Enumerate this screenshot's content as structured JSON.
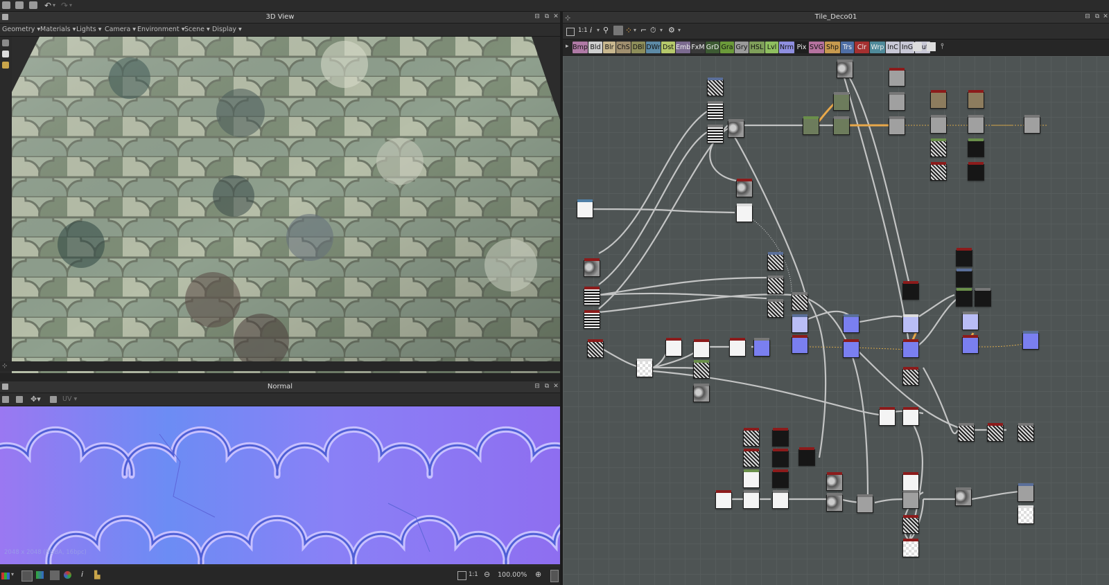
{
  "view3d": {
    "title": "3D View",
    "menu": [
      "Geometry",
      "Materials",
      "Lights",
      "Camera",
      "Environment",
      "Scene",
      "Display"
    ]
  },
  "view2d": {
    "title": "Normal",
    "toolbar_label": "UV",
    "info": "2048 x 2048 (RGBA, 16bpc)",
    "ratio": "1:1",
    "zoom": "100.00%"
  },
  "graph": {
    "title": "Tile_Deco01",
    "ratio": "1:1",
    "info_glyph": "i",
    "categories": [
      {
        "label": "Bmp",
        "color": "#b07aa6"
      },
      {
        "label": "Bld",
        "color": "#cfcfcf"
      },
      {
        "label": "Blr",
        "color": "#c9b88f"
      },
      {
        "label": "ChS",
        "color": "#a08f6f"
      },
      {
        "label": "DBl",
        "color": "#8e8e5a"
      },
      {
        "label": "DWr",
        "color": "#5d8aa6"
      },
      {
        "label": "Dst",
        "color": "#b6c96b"
      },
      {
        "label": "Emb",
        "color": "#7b6a8f"
      },
      {
        "label": "FxM",
        "color": "#3a3a3a"
      },
      {
        "label": "GrD",
        "color": "#3d5a33"
      },
      {
        "label": "Gra",
        "color": "#6b9a3a"
      },
      {
        "label": "Gry",
        "color": "#9a9a9a"
      },
      {
        "label": "HSL",
        "color": "#7f9f5a"
      },
      {
        "label": "Lvl",
        "color": "#8fbf5f"
      },
      {
        "label": "Nrm",
        "color": "#8f8fe0"
      },
      {
        "label": "Pix",
        "color": "#1e1e1e"
      },
      {
        "label": "SVG",
        "color": "#b5729f"
      },
      {
        "label": "Shp",
        "color": "#c79a4f"
      },
      {
        "label": "Trs",
        "color": "#4f6fa5"
      },
      {
        "label": "Clr",
        "color": "#a53030"
      },
      {
        "label": "Wrp",
        "color": "#4f8a9a"
      },
      {
        "label": "InC",
        "color": "#c8c8d6"
      },
      {
        "label": "InG",
        "color": "#c8c8d6"
      },
      {
        "label": "Out",
        "color": "#c8c8d6"
      }
    ]
  },
  "icons": {
    "close": "close-icon",
    "float": "float-icon",
    "maximize": "maximize-icon"
  }
}
